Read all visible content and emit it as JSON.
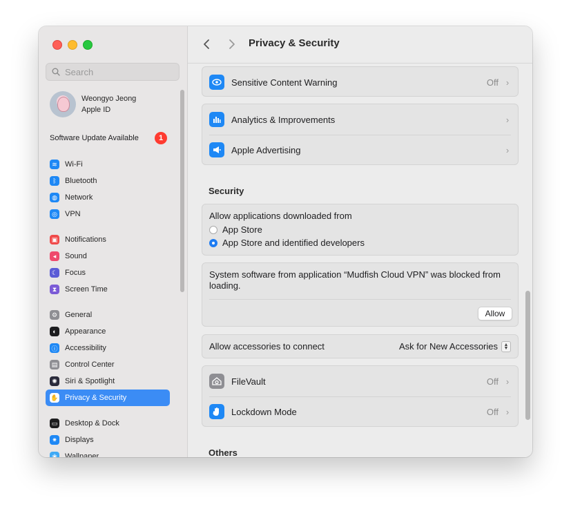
{
  "window": {
    "title": "Privacy & Security"
  },
  "sidebar": {
    "search_placeholder": "Search",
    "profile": {
      "name": "Weongyo Jeong",
      "subtitle": "Apple ID"
    },
    "software_update": {
      "label": "Software Update Available",
      "count": "1"
    },
    "items": [
      {
        "label": "Wi-Fi",
        "icon": "wifi-icon",
        "color": "#1e88f5",
        "glyph": "≋",
        "gap": false
      },
      {
        "label": "Bluetooth",
        "icon": "bluetooth-icon",
        "color": "#1e88f5",
        "glyph": "ᛒ",
        "gap": false
      },
      {
        "label": "Network",
        "icon": "globe-icon",
        "color": "#1e88f5",
        "glyph": "◍",
        "gap": false
      },
      {
        "label": "VPN",
        "icon": "vpn-icon",
        "color": "#1e88f5",
        "glyph": "◎",
        "gap": false
      },
      {
        "label": "Notifications",
        "icon": "bell-icon",
        "color": "#f04b4b",
        "glyph": "▣",
        "gap": true
      },
      {
        "label": "Sound",
        "icon": "speaker-icon",
        "color": "#ef4a6d",
        "glyph": "◂",
        "gap": false
      },
      {
        "label": "Focus",
        "icon": "moon-icon",
        "color": "#5b5bd6",
        "glyph": "☾",
        "gap": false
      },
      {
        "label": "Screen Time",
        "icon": "hourglass-icon",
        "color": "#7b5bd6",
        "glyph": "⧗",
        "gap": false
      },
      {
        "label": "General",
        "icon": "gear-icon",
        "color": "#8e8e93",
        "glyph": "⚙",
        "gap": true
      },
      {
        "label": "Appearance",
        "icon": "appearance-icon",
        "color": "#1c1c1e",
        "glyph": "◐",
        "gap": false
      },
      {
        "label": "Accessibility",
        "icon": "accessibility-icon",
        "color": "#1e88f5",
        "glyph": "ⓘ",
        "gap": false
      },
      {
        "label": "Control Center",
        "icon": "control-center-icon",
        "color": "#8e8e93",
        "glyph": "▤",
        "gap": false
      },
      {
        "label": "Siri & Spotlight",
        "icon": "siri-icon",
        "color": "#2a2a3a",
        "glyph": "✺",
        "gap": false
      },
      {
        "label": "Privacy & Security",
        "icon": "hand-icon",
        "color": "#1e88f5",
        "glyph": "✋",
        "gap": false,
        "active": true
      },
      {
        "label": "Desktop & Dock",
        "icon": "dock-icon",
        "color": "#1c1c1e",
        "glyph": "▭",
        "gap": true
      },
      {
        "label": "Displays",
        "icon": "display-icon",
        "color": "#1e88f5",
        "glyph": "✷",
        "gap": false
      },
      {
        "label": "Wallpaper",
        "icon": "wallpaper-icon",
        "color": "#3fa9f5",
        "glyph": "❀",
        "gap": false
      }
    ]
  },
  "main": {
    "sensitive": {
      "label": "Sensitive Content Warning",
      "value": "Off",
      "icon": "eye-icon",
      "color": "#1e88f5"
    },
    "analytics": {
      "label": "Analytics & Improvements",
      "icon": "bar-chart-icon",
      "color": "#1e88f5"
    },
    "advertising": {
      "label": "Apple Advertising",
      "icon": "megaphone-icon",
      "color": "#1e88f5"
    },
    "security_title": "Security",
    "allow_apps": {
      "title": "Allow applications downloaded from",
      "options": [
        {
          "label": "App Store",
          "selected": false
        },
        {
          "label": "App Store and identified developers",
          "selected": true
        }
      ]
    },
    "blocked": {
      "message": "System software from application “Mudfish Cloud VPN” was blocked from loading.",
      "button": "Allow"
    },
    "accessories": {
      "label": "Allow accessories to connect",
      "value": "Ask for New Accessories"
    },
    "filevault": {
      "label": "FileVault",
      "value": "Off",
      "icon": "filevault-icon",
      "color": "#8e8e93"
    },
    "lockdown": {
      "label": "Lockdown Mode",
      "value": "Off",
      "icon": "hand-icon",
      "color": "#1e88f5"
    },
    "others_title": "Others"
  }
}
